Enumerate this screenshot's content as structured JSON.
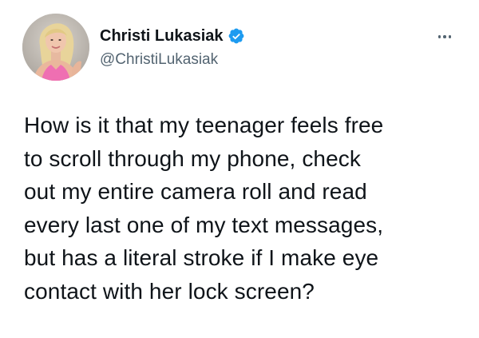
{
  "author": {
    "display_name": "Christi Lukasiak",
    "handle": "@ChristiLukasiak",
    "verified": true,
    "verified_color": "#1d9bf0",
    "avatar_icon": "profile-photo"
  },
  "more_icon": "more-horizontal-icon",
  "tweet": {
    "lines": [
      "How is it that my teenager feels free",
      "to scroll through my phone, check",
      "out my entire camera roll and read",
      "every last one of my text messages,",
      "but has a literal stroke if I make eye",
      "contact with her lock screen?"
    ]
  }
}
